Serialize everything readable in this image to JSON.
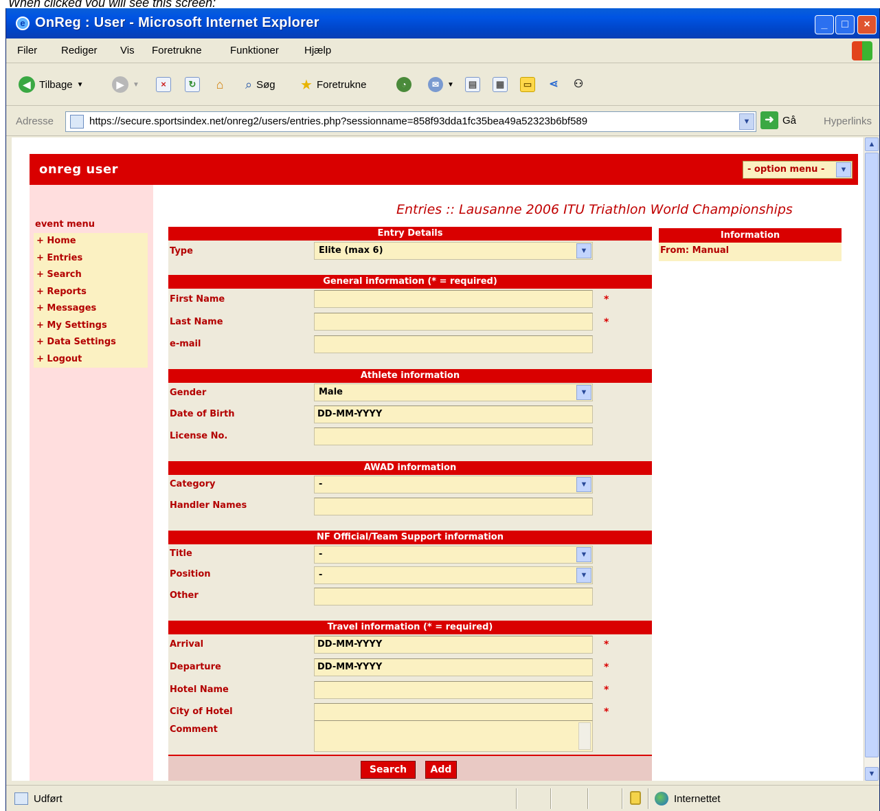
{
  "caption": "When clicked you will see this screen:",
  "window": {
    "title": "OnReg : User - Microsoft Internet Explorer"
  },
  "menu": [
    "Filer",
    "Rediger",
    "Vis",
    "Foretrukne",
    "Funktioner",
    "Hjælp"
  ],
  "toolbar": {
    "back": "Tilbage",
    "search": "Søg",
    "favorites": "Foretrukne"
  },
  "address": {
    "label": "Adresse",
    "url": "https://secure.sportsindex.net/onreg2/users/entries.php?sessionname=858f93dda1fc35bea49a52323b6bf589",
    "go": "Gå",
    "links": "Hyperlinks"
  },
  "status": {
    "text": "Udført",
    "zone": "Internettet"
  },
  "page": {
    "app_title": "onreg user",
    "option_menu": "- option menu -",
    "heading": "Entries :: Lausanne 2006 ITU Triathlon World Championships",
    "event_menu": {
      "title": "event menu",
      "items": [
        "+ Home",
        "+ Entries",
        "+ Search",
        "+ Reports",
        "+ Messages",
        "+ My Settings",
        "+ Data Settings",
        "+ Logout"
      ]
    },
    "sections": {
      "entry_details": "Entry Details",
      "general": "General information (* = required)",
      "athlete": "Athlete information",
      "awad": "AWAD information",
      "nf": "NF Official/Team Support information",
      "travel": "Travel information (* = required)"
    },
    "labels": {
      "type": "Type",
      "first_name": "First Name",
      "last_name": "Last Name",
      "email": "e-mail",
      "gender": "Gender",
      "dob": "Date of Birth",
      "license": "License No.",
      "category": "Category",
      "handler": "Handler Names",
      "title": "Title",
      "position": "Position",
      "other": "Other",
      "arrival": "Arrival",
      "departure": "Departure",
      "hotel_name": "Hotel Name",
      "hotel_city": "City of Hotel",
      "comment": "Comment"
    },
    "values": {
      "type": "Elite (max 6)",
      "first_name": "",
      "last_name": "",
      "email": "",
      "gender": "Male",
      "dob": "DD-MM-YYYY",
      "license": "",
      "category": "-",
      "handler": "",
      "title": "-",
      "position": "-",
      "other": "",
      "arrival": "DD-MM-YYYY",
      "departure": "DD-MM-YYYY",
      "hotel_name": "",
      "hotel_city": ""
    },
    "required_mark": "*",
    "buttons": {
      "search": "Search",
      "add": "Add"
    },
    "info": {
      "title": "Information",
      "from": "From: Manual"
    }
  },
  "colors": {
    "brand_red": "#d90000",
    "field_bg": "#fbf1c2",
    "menu_bg": "#ffdede"
  }
}
